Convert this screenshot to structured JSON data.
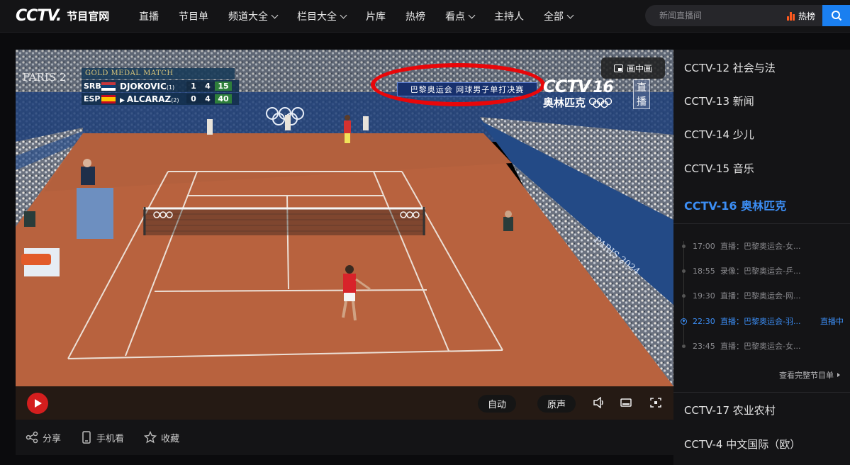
{
  "header": {
    "logo_text": "CCTV.",
    "logo_sub": "节目官网",
    "nav": [
      {
        "label": "直播",
        "dropdown": false
      },
      {
        "label": "节目单",
        "dropdown": false
      },
      {
        "label": "频道大全",
        "dropdown": true
      },
      {
        "label": "栏目大全",
        "dropdown": true
      },
      {
        "label": "片库",
        "dropdown": false
      },
      {
        "label": "热榜",
        "dropdown": false
      },
      {
        "label": "看点",
        "dropdown": true
      },
      {
        "label": "主持人",
        "dropdown": false
      },
      {
        "label": "全部",
        "dropdown": true
      }
    ],
    "search_placeholder": "新闻直播间",
    "hot_label": "热榜"
  },
  "player": {
    "pip_label": "画中画",
    "scoreboard": {
      "event": "GOLD MEDAL MATCH",
      "venue_text": "PARIS 2",
      "rows": [
        {
          "country": "SRB",
          "name": "DJOKOVIC",
          "seed": "(1)",
          "set1": "1",
          "set2": "4",
          "points": "15"
        },
        {
          "country": "ESP",
          "name": "ALCARAZ",
          "seed": "(2)",
          "set1": "0",
          "set2": "4",
          "points": "40"
        }
      ]
    },
    "banner": "巴黎奥运会 网球男子单打决赛",
    "channel_bug": {
      "brand": "CCTV",
      "number": "16",
      "name": "奥林匹克",
      "live": "直播"
    },
    "court_ad_text": "PARIS 2024",
    "controls": {
      "auto_label": "自动",
      "audio_label": "原声"
    }
  },
  "actions": [
    {
      "label": "分享",
      "icon": "share-icon"
    },
    {
      "label": "手机看",
      "icon": "phone-icon"
    },
    {
      "label": "收藏",
      "icon": "star-icon"
    }
  ],
  "sidebar": {
    "channels_top": [
      {
        "label": "CCTV-12 社会与法",
        "active": false
      },
      {
        "label": "CCTV-13 新闻",
        "active": false
      },
      {
        "label": "CCTV-14 少儿",
        "active": false
      },
      {
        "label": "CCTV-15 音乐",
        "active": false
      },
      {
        "label": "CCTV-16 奥林匹克",
        "active": true
      }
    ],
    "schedule": [
      {
        "time": "17:00",
        "title": "直播：巴黎奥运会-女...",
        "now": false,
        "badge": ""
      },
      {
        "time": "18:55",
        "title": "录像：巴黎奥运会-乒...",
        "now": false,
        "badge": ""
      },
      {
        "time": "19:30",
        "title": "直播：巴黎奥运会-网...",
        "now": false,
        "badge": ""
      },
      {
        "time": "22:30",
        "title": "直播：巴黎奥运会-羽...",
        "now": true,
        "badge": "直播中"
      },
      {
        "time": "23:45",
        "title": "直播：巴黎奥运会-女...",
        "now": false,
        "badge": ""
      }
    ],
    "full_schedule_link": "查看完整节目单",
    "channels_bottom": [
      {
        "label": "CCTV-17 农业农村"
      },
      {
        "label": "CCTV-4 中文国际（欧）"
      }
    ]
  },
  "colors": {
    "accent_blue": "#3c8ef5",
    "search_blue": "#1a7ff0",
    "annotation_red": "#e8070a",
    "clay": "#b8623e"
  }
}
